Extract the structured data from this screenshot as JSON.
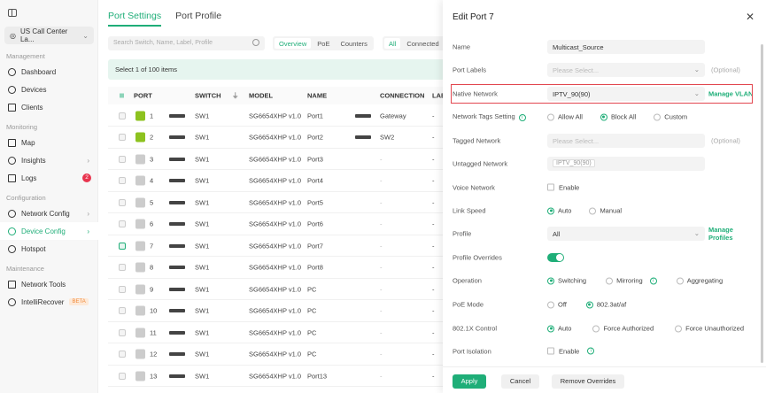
{
  "sidebar": {
    "site": "US Call Center La...",
    "sections": {
      "management": "Management",
      "monitoring": "Monitoring",
      "configuration": "Configuration",
      "maintenance": "Maintenance"
    },
    "items": [
      {
        "label": "Dashboard"
      },
      {
        "label": "Devices"
      },
      {
        "label": "Clients"
      },
      {
        "label": "Map"
      },
      {
        "label": "Insights"
      },
      {
        "label": "Logs",
        "badge": "2"
      },
      {
        "label": "Network Config"
      },
      {
        "label": "Device Config"
      },
      {
        "label": "Hotspot"
      },
      {
        "label": "Network Tools"
      },
      {
        "label": "IntelliRecover",
        "badge": "BETA"
      }
    ]
  },
  "main": {
    "tabs": [
      "Port Settings",
      "Port Profile"
    ],
    "search_placeholder": "Search Switch, Name, Label, Profile",
    "views": [
      "Overview",
      "PoE",
      "Counters"
    ],
    "filters": [
      "All",
      "Connected"
    ],
    "selection": "Select 1 of 100 items",
    "columns": [
      "PORT",
      "SWITCH",
      "MODEL",
      "NAME",
      "CONNECTION",
      "LAB"
    ],
    "rows": [
      {
        "port": "1",
        "switch": "SW1",
        "model": "SG6654XHP v1.0",
        "name": "Port1",
        "connection": "Gateway",
        "label": "-",
        "status": "up-uplink",
        "checked": false
      },
      {
        "port": "2",
        "switch": "SW1",
        "model": "SG6654XHP v1.0",
        "name": "Port2",
        "connection": "SW2",
        "label": "-",
        "status": "up",
        "checked": false
      },
      {
        "port": "3",
        "switch": "SW1",
        "model": "SG6654XHP v1.0",
        "name": "Port3",
        "connection": "-",
        "label": "-",
        "status": "down",
        "checked": false
      },
      {
        "port": "4",
        "switch": "SW1",
        "model": "SG6654XHP v1.0",
        "name": "Port4",
        "connection": "-",
        "label": "-",
        "status": "down",
        "checked": false
      },
      {
        "port": "5",
        "switch": "SW1",
        "model": "SG6654XHP v1.0",
        "name": "Port5",
        "connection": "-",
        "label": "-",
        "status": "down",
        "checked": false
      },
      {
        "port": "6",
        "switch": "SW1",
        "model": "SG6654XHP v1.0",
        "name": "Port6",
        "connection": "-",
        "label": "-",
        "status": "down",
        "checked": false
      },
      {
        "port": "7",
        "switch": "SW1",
        "model": "SG6654XHP v1.0",
        "name": "Port7",
        "connection": "-",
        "label": "-",
        "status": "down",
        "checked": true
      },
      {
        "port": "8",
        "switch": "SW1",
        "model": "SG6654XHP v1.0",
        "name": "Port8",
        "connection": "-",
        "label": "-",
        "status": "down",
        "checked": false
      },
      {
        "port": "9",
        "switch": "SW1",
        "model": "SG6654XHP v1.0",
        "name": "PC",
        "connection": "-",
        "label": "-",
        "status": "down",
        "checked": false
      },
      {
        "port": "10",
        "switch": "SW1",
        "model": "SG6654XHP v1.0",
        "name": "PC",
        "connection": "-",
        "label": "-",
        "status": "down",
        "checked": false
      },
      {
        "port": "11",
        "switch": "SW1",
        "model": "SG6654XHP v1.0",
        "name": "PC",
        "connection": "-",
        "label": "-",
        "status": "down",
        "checked": false
      },
      {
        "port": "12",
        "switch": "SW1",
        "model": "SG6654XHP v1.0",
        "name": "PC",
        "connection": "-",
        "label": "-",
        "status": "down",
        "checked": false
      },
      {
        "port": "13",
        "switch": "SW1",
        "model": "SG6654XHP v1.0",
        "name": "Port13",
        "connection": "-",
        "label": "-",
        "status": "down",
        "checked": false
      }
    ]
  },
  "drawer": {
    "title": "Edit Port 7",
    "name_label": "Name",
    "name_value": "Multicast_Source",
    "labels_label": "Port Labels",
    "labels_placeholder": "Please Select...",
    "optional": "(Optional)",
    "native_label": "Native Network",
    "native_value": "IPTV_90(90)",
    "manage_vlan": "Manage VLAN",
    "tags_label": "Network Tags Setting",
    "tags_options": [
      "Allow All",
      "Block All",
      "Custom"
    ],
    "tags_selected": "Block All",
    "tagged_label": "Tagged Network",
    "tagged_placeholder": "Please Select...",
    "untagged_label": "Untagged Network",
    "untagged_value": "IPTV_90(90)",
    "voice_label": "Voice Network",
    "enable": "Enable",
    "speed_label": "Link Speed",
    "speed_options": [
      "Auto",
      "Manual"
    ],
    "profile_label": "Profile",
    "profile_value": "All",
    "manage_profiles": "Manage Profiles",
    "overrides_label": "Profile Overrides",
    "overrides_on": true,
    "operation_label": "Operation",
    "operation_options": [
      "Switching",
      "Mirroring",
      "Aggregating"
    ],
    "poe_label": "PoE Mode",
    "poe_options": [
      "Off",
      "802.3at/af"
    ],
    "dot1x_label": "802.1X Control",
    "dot1x_options": [
      "Auto",
      "Force Authorized",
      "Force Unauthorized"
    ],
    "isolation_label": "Port Isolation",
    "apply": "Apply",
    "cancel": "Cancel",
    "remove": "Remove Overrides"
  }
}
